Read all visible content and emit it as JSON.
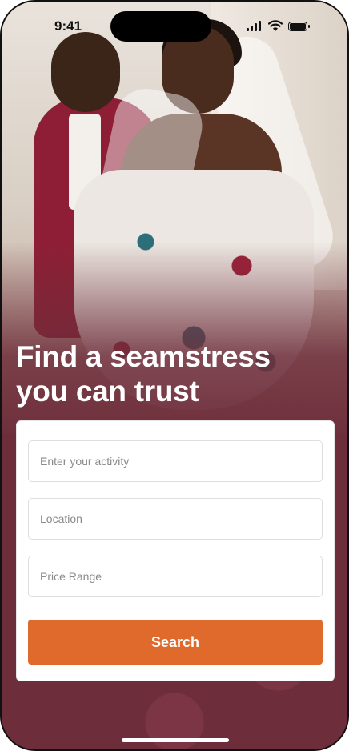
{
  "status_bar": {
    "time": "9:41"
  },
  "hero": {
    "image_description_icon": "wedding-couple-photo",
    "headline_line1": "Find a seamstress",
    "headline_line2": "you can trust"
  },
  "search_form": {
    "activity_placeholder": "Enter your activity",
    "location_placeholder": "Location",
    "price_placeholder": "Price Range",
    "search_label": "Search"
  },
  "colors": {
    "brand_maroon": "#6d2d3a",
    "accent_orange": "#e06a2b",
    "card_bg": "#ffffff"
  }
}
